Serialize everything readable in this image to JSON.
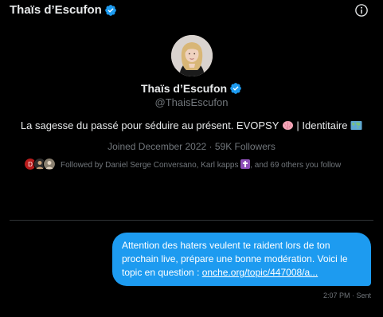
{
  "header": {
    "title": "Thaïs d’Escufon",
    "info_icon": "info-icon"
  },
  "profile": {
    "name": "Thaïs d’Escufon",
    "handle": "@ThaisEscufon",
    "bio_text": "La sagesse du passé pour séduire au présent. EVOPSY ",
    "bio_separator": " | Identitaire ",
    "bio_emoji_1": "brain-emoji",
    "bio_emoji_2": "world-map-emoji",
    "joined": "Joined December 2022 · 59K Followers",
    "verified_icon": "verified-badge-icon"
  },
  "followed_by": {
    "prefix": "Followed by Daniel Serge Conversano, Karl kapps ",
    "suffix": ", and 69 others you follow",
    "emoji": "latin-cross-emoji"
  },
  "message": {
    "text": "Attention des haters veulent te raident lors de ton prochain live, prépare une bonne modération. Voici le topic en question : ",
    "link": "onche.org/topic/447008/a...",
    "timestamp": "2:07 PM · Sent"
  },
  "colors": {
    "background": "#000000",
    "accent": "#1d9bf0",
    "text": "#e7e9ea",
    "muted": "#71767b"
  }
}
